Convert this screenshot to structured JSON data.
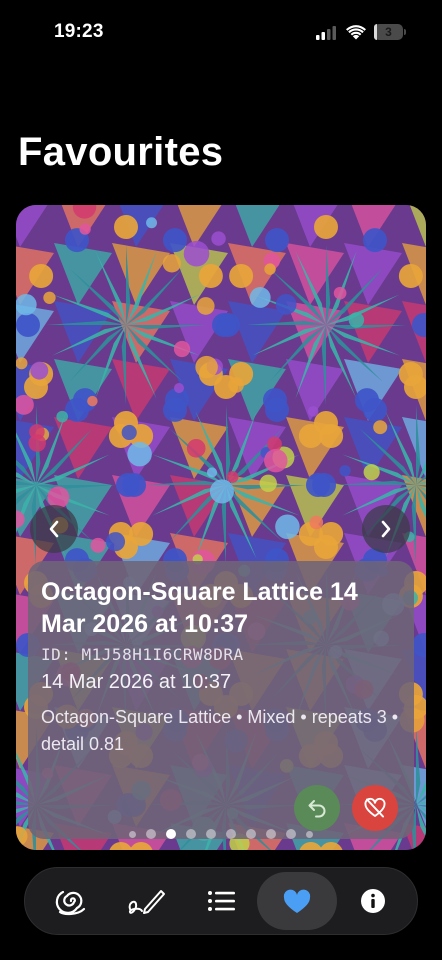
{
  "status_bar": {
    "time": "19:23",
    "battery_level": "3",
    "icons": [
      "signal-icon",
      "wifi-icon",
      "battery-icon"
    ]
  },
  "page": {
    "title": "Favourites"
  },
  "card": {
    "title": "Octagon-Square Lattice 14 Mar 2026 at 10:37",
    "id_text": "ID: M1J58H1I6CRW8DRA",
    "date": "14 Mar 2026 at 10:37",
    "description": "Octagon-Square Lattice • Mixed • repeats 3 • detail 0.81",
    "nav_icons": [
      "chevron-left-icon",
      "chevron-right-icon"
    ],
    "actions": [
      "restore-icon",
      "heart-slash-icon"
    ],
    "action_colors": {
      "restore": "#5a8a58",
      "unfavourite": "#d9443e"
    },
    "pagination": {
      "count": 10,
      "active_index": 2
    }
  },
  "tab_bar": {
    "active_index": 3,
    "accent": "#4a9ff5",
    "tabs": [
      "shell-icon",
      "pen-icon",
      "list-icon",
      "heart-icon",
      "info-icon"
    ]
  }
}
